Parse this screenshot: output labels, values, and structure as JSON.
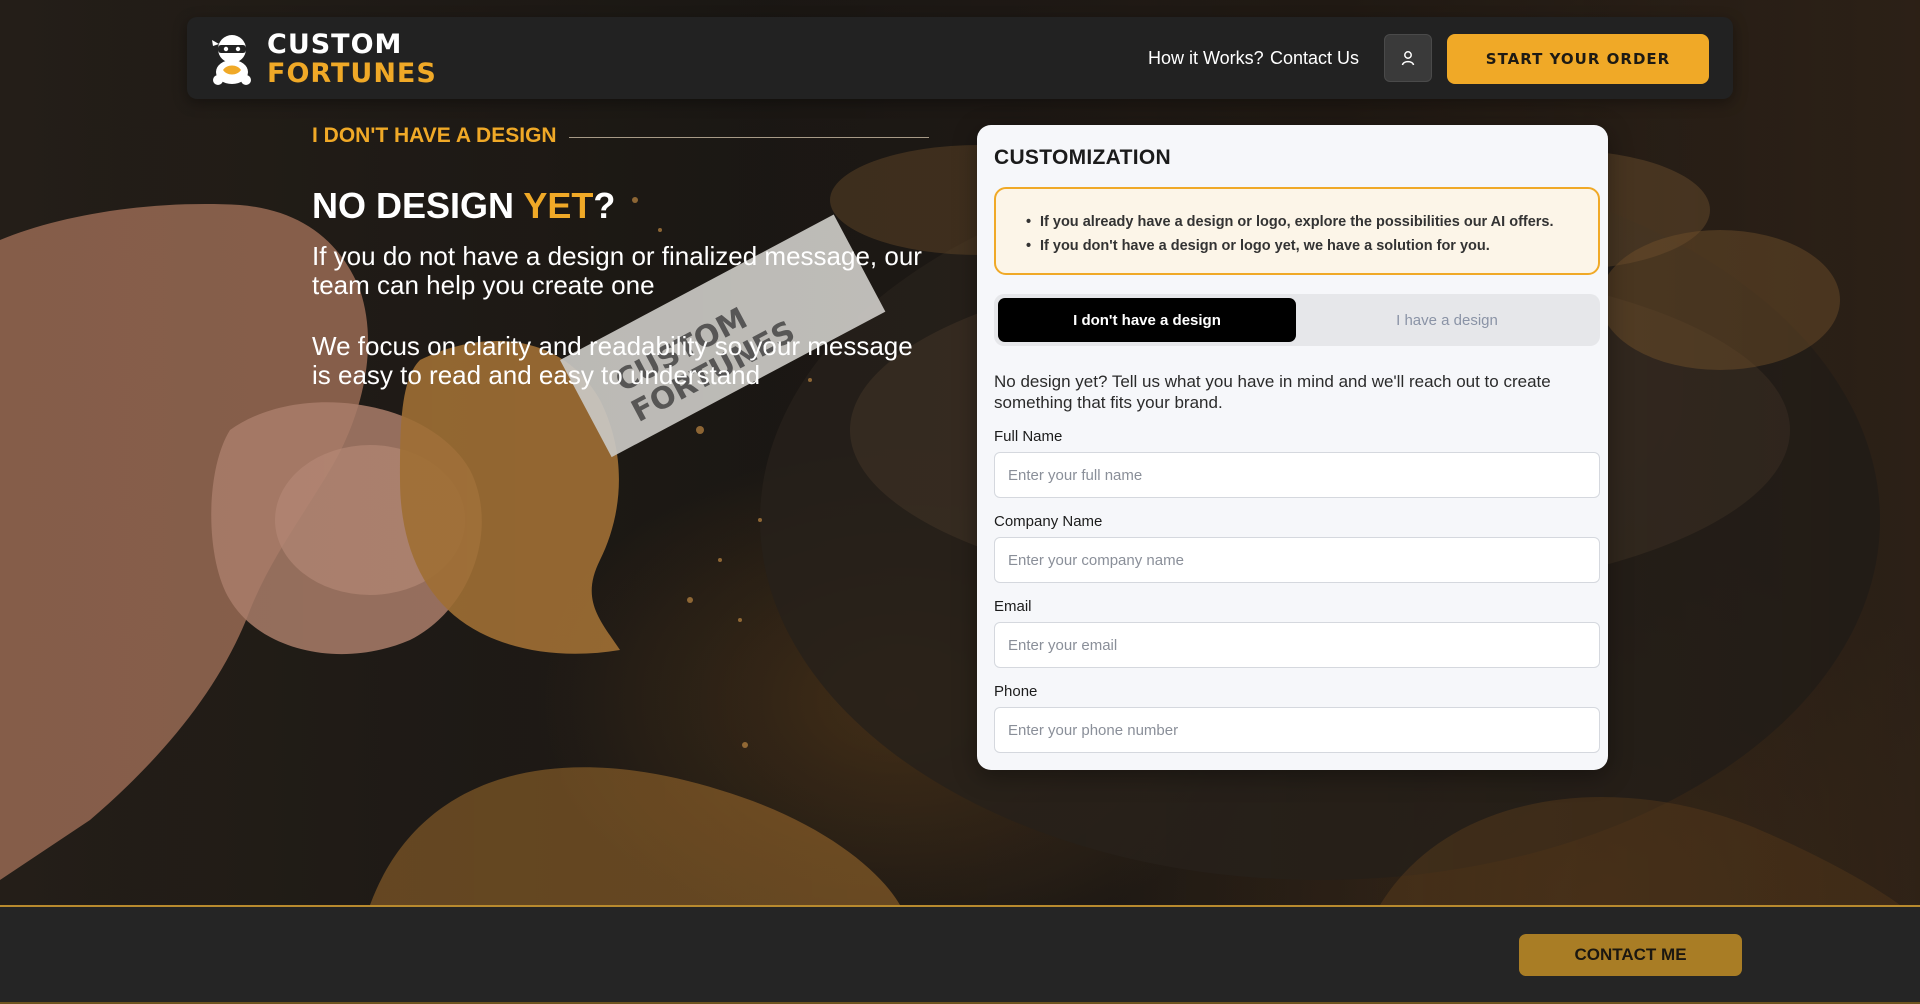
{
  "header": {
    "logo_line1": "CUSTOM",
    "logo_line2": "FORTUNES",
    "nav": [
      "How it Works?",
      "Contact Us"
    ],
    "cta_label": "START YOUR ORDER"
  },
  "hero": {
    "eyebrow": "I DON'T HAVE A DESIGN",
    "title_part1": "NO DESIGN ",
    "title_accent": "YET",
    "title_part2": "?",
    "paragraph1": "If you do not have a design or finalized message, our team can help you create one",
    "paragraph2": "We focus on clarity and readability so your message is easy to read and easy to understand"
  },
  "form": {
    "title": "CUSTOMIZATION",
    "info_items": [
      "If you already have a design or logo, explore the possibilities our AI offers.",
      "If you don't have a design or logo yet, we have a solution for you."
    ],
    "tabs": [
      {
        "label": "I don't have a design",
        "active": true
      },
      {
        "label": "I have a design",
        "active": false
      }
    ],
    "intro": "No design yet? Tell us what you have in mind and we'll reach out to create something that fits your brand.",
    "fields": [
      {
        "label": "Full Name",
        "placeholder": "Enter your full name"
      },
      {
        "label": "Company Name",
        "placeholder": "Enter your company name"
      },
      {
        "label": "Email",
        "placeholder": "Enter your email"
      },
      {
        "label": "Phone",
        "placeholder": "Enter your phone number"
      }
    ]
  },
  "footer": {
    "contact_label": "CONTACT ME"
  },
  "colors": {
    "accent": "#f0a927",
    "header_bg": "#222222",
    "footer_bg": "#252525",
    "active_tab": "#000000"
  },
  "icons": [
    "ninja-logo-icon",
    "user-icon"
  ]
}
